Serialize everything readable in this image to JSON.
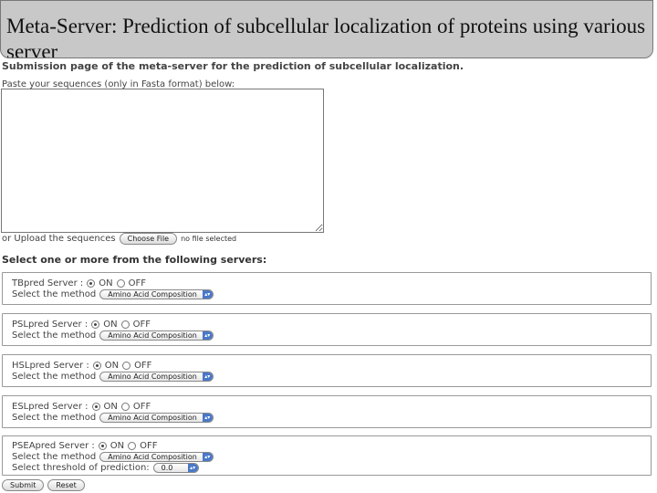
{
  "title": "Meta-Server: Prediction of subcellular localization of proteins using various server",
  "subtitle": "Submission page of the meta-server for the prediction of subcellular localization.",
  "paste_label": "Paste your sequences (only in Fasta format) below:",
  "upload": {
    "label": "or Upload the sequences",
    "button": "Choose File",
    "status": "no file selected"
  },
  "select_heading": "Select one or more from the following servers:",
  "on_label": "ON",
  "off_label": "OFF",
  "method_label": "Select the method",
  "method_value": "Amino Acid Composition",
  "servers": [
    {
      "name": "TBpred Server :",
      "state": "ON"
    },
    {
      "name": "PSLpred Server :",
      "state": "ON"
    },
    {
      "name": "HSLpred Server :",
      "state": "ON"
    },
    {
      "name": "ESLpred Server :",
      "state": "ON"
    },
    {
      "name": "PSEApred Server :",
      "state": "ON"
    }
  ],
  "threshold": {
    "label": "Select threshold of prediction:",
    "value": "0.0"
  },
  "submit_label": "Submit",
  "reset_label": "Reset"
}
